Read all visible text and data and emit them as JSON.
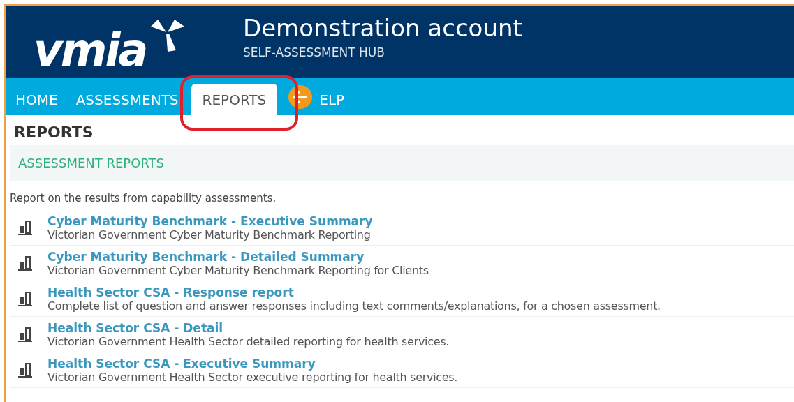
{
  "header": {
    "logo": "vmia",
    "title": "Demonstration account",
    "subtitle": "SELF-ASSESSMENT HUB"
  },
  "tabs": [
    {
      "label": "HOME",
      "selected": false
    },
    {
      "label": "ASSESSMENTS",
      "selected": false
    },
    {
      "label": "REPORTS",
      "selected": true,
      "highlighted": true
    },
    {
      "label": "ELP",
      "selected": false,
      "pointer": true
    }
  ],
  "page_title": "REPORTS",
  "section": {
    "title": "ASSESSMENT REPORTS",
    "intro": "Report on the results from capability assessments."
  },
  "reports": [
    {
      "title": "Cyber Maturity Benchmark - Executive Summary",
      "description": "Victorian Government Cyber Maturity Benchmark Reporting"
    },
    {
      "title": "Cyber Maturity Benchmark - Detailed Summary",
      "description": "Victorian Government Cyber Maturity Benchmark Reporting for Clients"
    },
    {
      "title": "Health Sector CSA - Response report",
      "description": "Complete list of question and answer responses including text comments/explanations, for a chosen assessment."
    },
    {
      "title": "Health Sector CSA - Detail",
      "description": "Victorian Government Health Sector detailed reporting for health services."
    },
    {
      "title": "Health Sector CSA - Executive Summary",
      "description": "Victorian Government Health Sector executive reporting for health services."
    }
  ]
}
